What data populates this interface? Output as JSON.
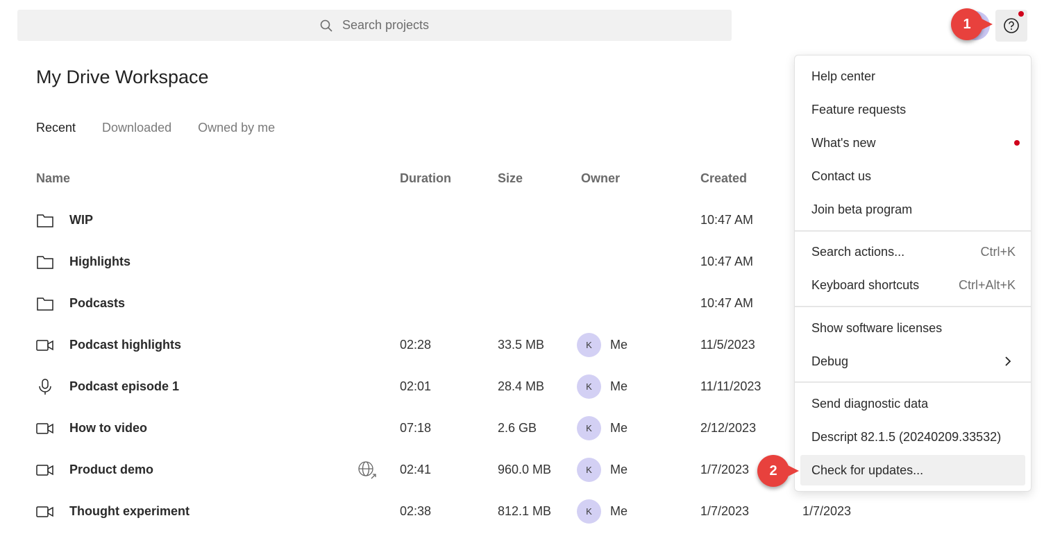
{
  "search": {
    "placeholder": "Search projects"
  },
  "workspace_title": "My Drive Workspace",
  "tabs": [
    {
      "label": "Recent",
      "active": true
    },
    {
      "label": "Downloaded",
      "active": false
    },
    {
      "label": "Owned by me",
      "active": false
    }
  ],
  "columns": {
    "name": "Name",
    "duration": "Duration",
    "size": "Size",
    "owner": "Owner",
    "created": "Created"
  },
  "rows": [
    {
      "icon": "folder-icon",
      "name": "WIP",
      "duration": "",
      "size": "",
      "owner_initial": "",
      "owner": "",
      "created": "10:47 AM",
      "modified": ""
    },
    {
      "icon": "folder-icon",
      "name": "Highlights",
      "duration": "",
      "size": "",
      "owner_initial": "",
      "owner": "",
      "created": "10:47 AM",
      "modified": ""
    },
    {
      "icon": "folder-icon",
      "name": "Podcasts",
      "duration": "",
      "size": "",
      "owner_initial": "",
      "owner": "",
      "created": "10:47 AM",
      "modified": ""
    },
    {
      "icon": "video-icon",
      "name": "Podcast highlights",
      "duration": "02:28",
      "size": "33.5 MB",
      "owner_initial": "K",
      "owner": "Me",
      "created": "11/5/2023",
      "modified": ""
    },
    {
      "icon": "microphone-icon",
      "name": "Podcast episode 1",
      "duration": "02:01",
      "size": "28.4 MB",
      "owner_initial": "K",
      "owner": "Me",
      "created": "11/11/2023",
      "modified": ""
    },
    {
      "icon": "video-icon",
      "name": "How to video",
      "duration": "07:18",
      "size": "2.6 GB",
      "owner_initial": "K",
      "owner": "Me",
      "created": "2/12/2023",
      "modified": ""
    },
    {
      "icon": "video-icon",
      "name": "Product demo",
      "duration": "02:41",
      "size": "960.0 MB",
      "owner_initial": "K",
      "owner": "Me",
      "created": "1/7/2023",
      "modified": "",
      "published": true
    },
    {
      "icon": "video-icon",
      "name": "Thought experiment",
      "duration": "02:38",
      "size": "812.1 MB",
      "owner_initial": "K",
      "owner": "Me",
      "created": "1/7/2023",
      "modified": "1/7/2023"
    }
  ],
  "help_menu": {
    "group1": [
      {
        "label": "Help center"
      },
      {
        "label": "Feature requests"
      },
      {
        "label": "What's new",
        "new_indicator": true
      },
      {
        "label": "Contact us"
      },
      {
        "label": "Join beta program"
      }
    ],
    "group2": [
      {
        "label": "Search actions...",
        "shortcut": "Ctrl+K"
      },
      {
        "label": "Keyboard shortcuts",
        "shortcut": "Ctrl+Alt+K"
      }
    ],
    "group3": [
      {
        "label": "Show software licenses"
      },
      {
        "label": "Debug",
        "submenu": true
      }
    ],
    "group4": [
      {
        "label": "Send diagnostic data"
      },
      {
        "label": "Descript 82.1.5 (20240209.33532)"
      },
      {
        "label": "Check for updates...",
        "highlighted": true
      }
    ]
  },
  "callouts": [
    "1",
    "2"
  ],
  "colors": {
    "callout": "#e8413d",
    "avatar": "#d3d0f4",
    "notification_dot": "#d0021b"
  }
}
